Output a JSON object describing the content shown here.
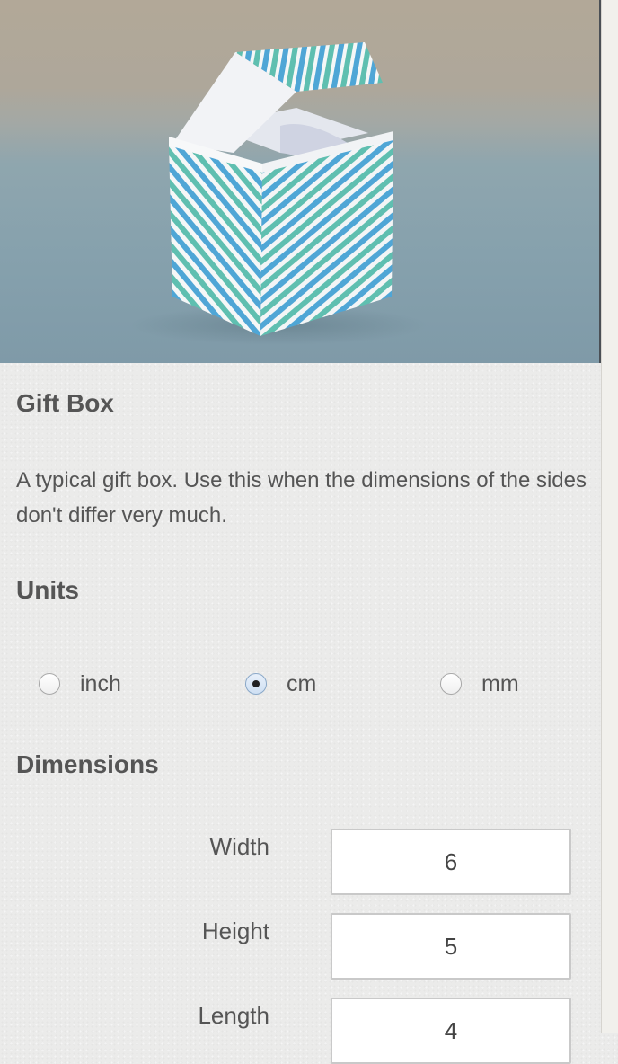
{
  "product": {
    "title": "Gift Box",
    "description": "A typical gift box. Use this when the dimensions of the sides don't differ very much."
  },
  "units": {
    "heading": "Units",
    "options": [
      {
        "label": "inch",
        "selected": false
      },
      {
        "label": "cm",
        "selected": true
      },
      {
        "label": "mm",
        "selected": false
      }
    ]
  },
  "dimensions": {
    "heading": "Dimensions",
    "fields": [
      {
        "label": "Width",
        "value": "6"
      },
      {
        "label": "Height",
        "value": "5"
      },
      {
        "label": "Length",
        "value": "4"
      }
    ]
  },
  "colors": {
    "stripe_teal": "#5fbfb0",
    "stripe_blue": "#4fa6d6",
    "background": "#ebebea"
  }
}
